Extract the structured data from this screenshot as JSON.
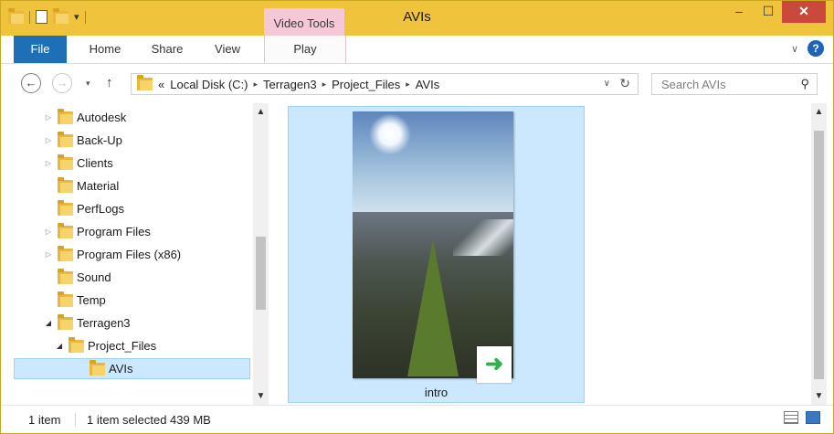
{
  "window": {
    "title": "AVIs",
    "context_tab_group": "Video Tools",
    "controls": {
      "minimize": "–",
      "maximize": "☐",
      "close": "✕"
    }
  },
  "ribbon": {
    "tabs": {
      "file": "File",
      "home": "Home",
      "share": "Share",
      "view": "View",
      "play": "Play"
    },
    "help": "?"
  },
  "address": {
    "overflow": "«",
    "crumbs": [
      "Local Disk (C:)",
      "Terragen3",
      "Project_Files",
      "AVIs"
    ],
    "separator": "▸"
  },
  "search": {
    "placeholder": "Search AVIs"
  },
  "nav_tree": [
    {
      "label": "Autodesk",
      "expand": "▷",
      "indent": 0
    },
    {
      "label": "Back-Up",
      "expand": "▷",
      "indent": 0
    },
    {
      "label": "Clients",
      "expand": "▷",
      "indent": 0
    },
    {
      "label": "Material",
      "expand": "",
      "indent": 0
    },
    {
      "label": "PerfLogs",
      "expand": "",
      "indent": 0
    },
    {
      "label": "Program Files",
      "expand": "▷",
      "indent": 0
    },
    {
      "label": "Program Files (x86)",
      "expand": "▷",
      "indent": 0
    },
    {
      "label": "Sound",
      "expand": "",
      "indent": 0
    },
    {
      "label": "Temp",
      "expand": "",
      "indent": 0
    },
    {
      "label": "Terragen3",
      "expand": "◢",
      "indent": 0
    },
    {
      "label": "Project_Files",
      "expand": "◢",
      "indent": 1
    },
    {
      "label": "AVIs",
      "expand": "",
      "indent": 2,
      "selected": true
    }
  ],
  "content": {
    "items": [
      {
        "name": "intro",
        "type": "video",
        "shortcut_glyph": "➜"
      }
    ]
  },
  "status": {
    "count": "1 item",
    "selection": "1 item selected  439 MB"
  },
  "colors": {
    "title_bar": "#f0c33d",
    "file_tab": "#1f6fb6",
    "context_tab": "#f4c8d6",
    "selection": "#cce8ff",
    "close_button": "#c94a3b"
  }
}
